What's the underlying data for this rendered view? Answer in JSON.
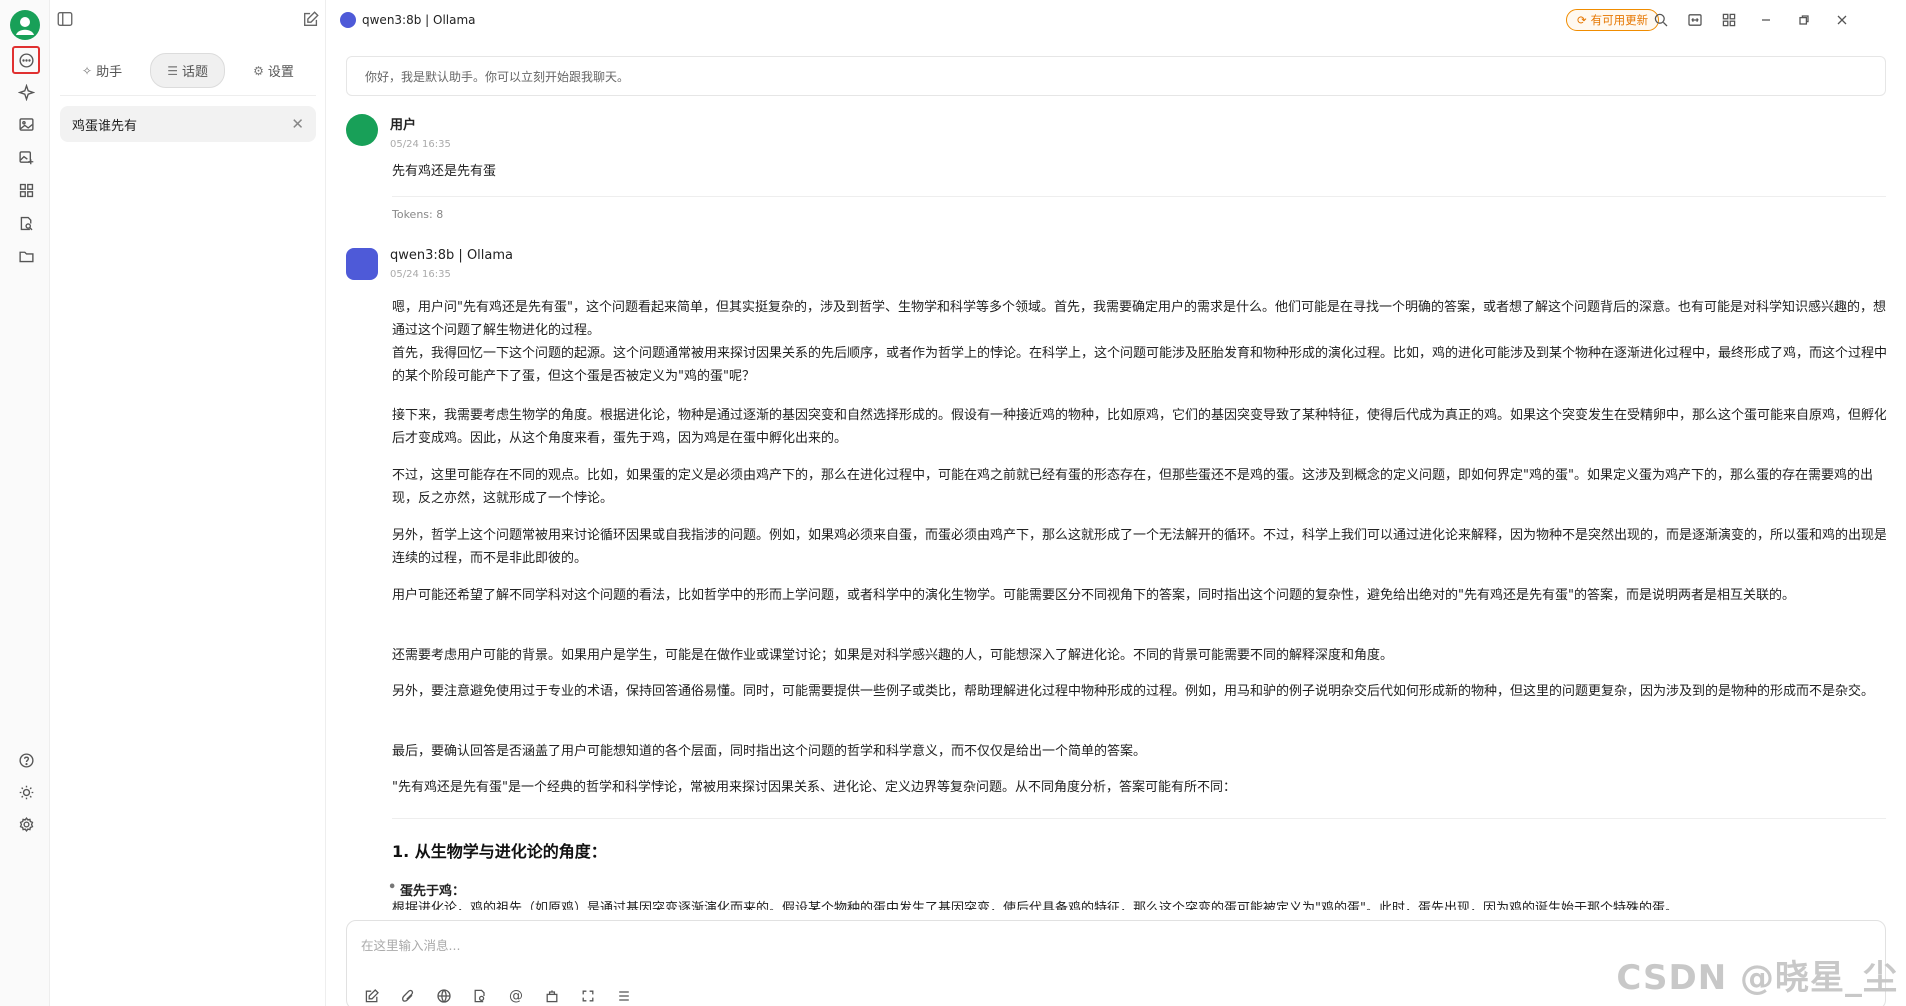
{
  "rail": {
    "icons": [
      "chat-icon",
      "sparkle-icon",
      "image-icon",
      "image-add-icon",
      "apps-icon",
      "doc-search-icon",
      "folder-icon",
      "help-icon",
      "theme-icon",
      "settings-icon"
    ]
  },
  "sidebar": {
    "tabs": [
      {
        "icon": "✧",
        "label": "助手"
      },
      {
        "icon": "☰",
        "label": "话题"
      },
      {
        "icon": "⚙",
        "label": "设置"
      }
    ],
    "topics": [
      {
        "title": "鸡蛋谁先有"
      }
    ]
  },
  "header": {
    "model": "qwen3:8b | Ollama",
    "update_label": "有可用更新"
  },
  "notice": "你好，我是默认助手。你可以立刻开始跟我聊天。",
  "messages": {
    "user": {
      "name": "用户",
      "time": "05/24 16:35",
      "text": "先有鸡还是先有蛋",
      "tokens": "Tokens: 8"
    },
    "bot": {
      "name": "qwen3:8b | Ollama",
      "time": "05/24 16:35",
      "paragraphs": [
        "嗯，用户问\"先有鸡还是先有蛋\"，这个问题看起来简单，但其实挺复杂的，涉及到哲学、生物学和科学等多个领域。首先，我需要确定用户的需求是什么。他们可能是在寻找一个明确的答案，或者想了解这个问题背后的深意。也有可能是对科学知识感兴趣的，想通过这个问题了解生物进化的过程。\n首先，我得回忆一下这个问题的起源。这个问题通常被用来探讨因果关系的先后顺序，或者作为哲学上的悖论。在科学上，这个问题可能涉及胚胎发育和物种形成的演化过程。比如，鸡的进化可能涉及到某个物种在逐渐进化过程中，最终形成了鸡，而这个过程中的某个阶段可能产下了蛋，但这个蛋是否被定义为\"鸡的蛋\"呢？",
        "接下来，我需要考虑生物学的角度。根据进化论，物种是通过逐渐的基因突变和自然选择形成的。假设有一种接近鸡的物种，比如原鸡，它们的基因突变导致了某种特征，使得后代成为真正的鸡。如果这个突变发生在受精卵中，那么这个蛋可能来自原鸡，但孵化后才变成鸡。因此，从这个角度来看，蛋先于鸡，因为鸡是在蛋中孵化出来的。",
        "不过，这里可能存在不同的观点。比如，如果蛋的定义是必须由鸡产下的，那么在进化过程中，可能在鸡之前就已经有蛋的形态存在，但那些蛋还不是鸡的蛋。这涉及到概念的定义问题，即如何界定\"鸡的蛋\"。如果定义蛋为鸡产下的，那么蛋的存在需要鸡的出现，反之亦然，这就形成了一个悖论。",
        "另外，哲学上这个问题常被用来讨论循环因果或自我指涉的问题。例如，如果鸡必须来自蛋，而蛋必须由鸡产下，那么这就形成了一个无法解开的循环。不过，科学上我们可以通过进化论来解释，因为物种不是突然出现的，而是逐渐演变的，所以蛋和鸡的出现是连续的过程，而不是非此即彼的。",
        "用户可能还希望了解不同学科对这个问题的看法，比如哲学中的形而上学问题，或者科学中的演化生物学。可能需要区分不同视角下的答案，同时指出这个问题的复杂性，避免给出绝对的\"先有鸡还是先有蛋\"的答案，而是说明两者是相互关联的。",
        "还需要考虑用户可能的背景。如果用户是学生，可能是在做作业或课堂讨论；如果是对科学感兴趣的人，可能想深入了解进化论。不同的背景可能需要不同的解释深度和角度。",
        "另外，要注意避免使用过于专业的术语，保持回答通俗易懂。同时，可能需要提供一些例子或类比，帮助理解进化过程中物种形成的过程。例如，用马和驴的例子说明杂交后代如何形成新的物种，但这里的问题更复杂，因为涉及到的是物种的形成而不是杂交。",
        "最后，要确认回答是否涵盖了用户可能想知道的各个层面，同时指出这个问题的哲学和科学意义，而不仅仅是给出一个简单的答案。",
        "\"先有鸡还是先有蛋\"是一个经典的哲学和科学悖论，常被用来探讨因果关系、进化论、定义边界等复杂问题。从不同角度分析，答案可能有所不同："
      ],
      "heading": "1. 从生物学与进化论的角度：",
      "bullet": "蛋先于鸡：",
      "cut_line": "根据进化论，鸡的祖先（如原鸡）是通过基因突变逐渐演化而来的。假设某个物种的蛋中发生了基因突变，使后代具备鸡的特征，那么这个突变的蛋可能被定义为\"鸡的蛋\"。此时，蛋先出现，因为鸡的诞生始于那个特殊的蛋。"
    }
  },
  "input": {
    "placeholder": "在这里输入消息..."
  },
  "watermark": "CSDN @晓星_尘"
}
